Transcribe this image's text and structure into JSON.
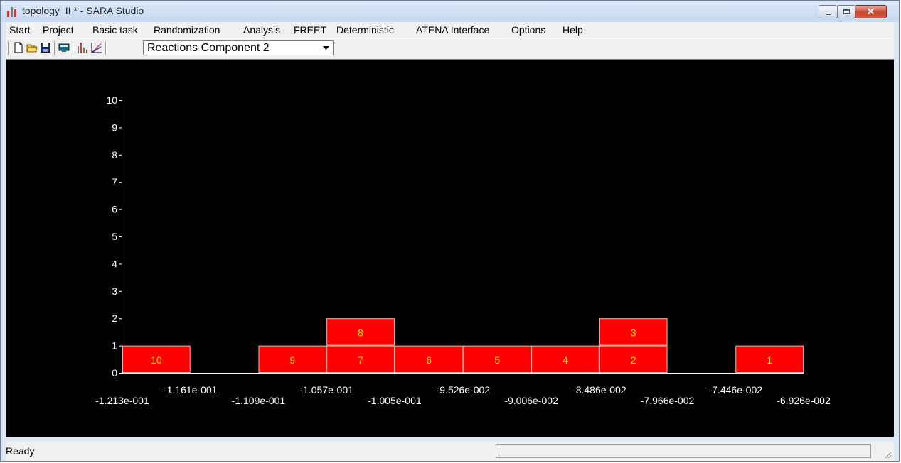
{
  "window": {
    "title": "topology_II * - SARA Studio",
    "controls": {
      "minimize": "minimize",
      "maximize": "maximize",
      "close": "✕"
    }
  },
  "menu": {
    "items": [
      "Start",
      "Project",
      "Basic task",
      "Randomization",
      "Analysis",
      "FREET",
      "Deterministic",
      "ATENA Interface",
      "Options",
      "Help"
    ]
  },
  "toolbar": {
    "icons": [
      "new-file-icon",
      "open-folder-icon",
      "save-icon",
      "monitor-icon",
      "histogram-icon",
      "distribution-icon"
    ],
    "combo": {
      "selected": "Reactions Component 2"
    }
  },
  "chart_data": {
    "type": "bar",
    "background": "#000000",
    "bar_color": "#ff0000",
    "axis_color": "#ffffff",
    "ylim": [
      0,
      10
    ],
    "yticks": [
      "0",
      "1",
      "2",
      "3",
      "4",
      "5",
      "6",
      "7",
      "8",
      "9",
      "10"
    ],
    "bin_edges": [
      -0.1213,
      -0.1161,
      -0.1109,
      -0.1057,
      -0.1005,
      -0.09526,
      -0.09006,
      -0.08486,
      -0.07966,
      -0.07446,
      -0.06926
    ],
    "xtick_labels": [
      "-1.213e-001",
      "-1.161e-001",
      "-1.109e-001",
      "-1.057e-001",
      "-1.005e-001",
      "-9.526e-002",
      "-9.006e-002",
      "-8.486e-002",
      "-7.966e-002",
      "-7.446e-002",
      "-6.926e-002"
    ],
    "counts": [
      1,
      0,
      1,
      2,
      1,
      1,
      1,
      2,
      0,
      1
    ],
    "sample_labels": [
      [
        "10"
      ],
      [],
      [
        "9"
      ],
      [
        "7",
        "8"
      ],
      [
        "6"
      ],
      [
        "5"
      ],
      [
        "4"
      ],
      [
        "2",
        "3"
      ],
      [],
      [
        "1"
      ]
    ]
  },
  "status": {
    "text": "Ready"
  }
}
